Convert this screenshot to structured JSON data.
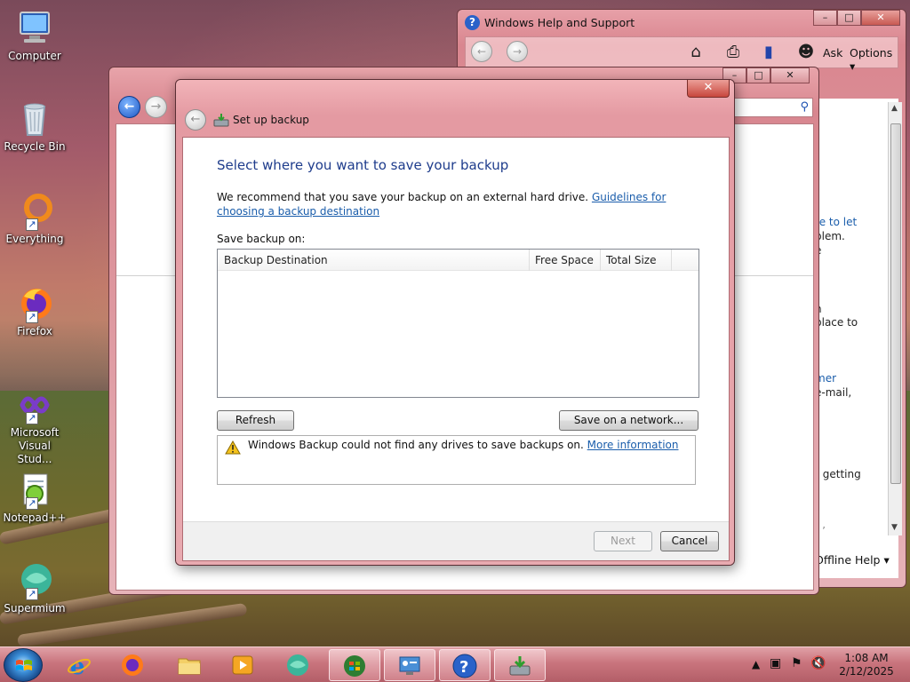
{
  "desktop": {
    "icons": [
      {
        "label": "Computer",
        "icon": "computer-icon"
      },
      {
        "label": "Recycle Bin",
        "icon": "recycle-bin-icon"
      },
      {
        "label": "Everything",
        "icon": "everything-icon"
      },
      {
        "label": "Firefox",
        "icon": "firefox-icon"
      },
      {
        "label": "Microsoft Visual Stud...",
        "icon": "visual-studio-icon"
      },
      {
        "label": "Notepad++",
        "icon": "notepadpp-icon"
      },
      {
        "label": "Supermium",
        "icon": "supermium-icon"
      }
    ]
  },
  "help_window": {
    "title": "Windows Help and Support",
    "toolbar": {
      "ask_label": "Ask",
      "options_label": "Options"
    },
    "snippets": [
      "te to let",
      "blem.",
      "e",
      "n",
      "place to",
      "mer",
      "e-mail,",
      "r getting",
      "- ’"
    ],
    "offline_label": "Offline Help"
  },
  "dialog": {
    "title": "Set up backup",
    "heading": "Select where you want to save your backup",
    "recommend_text": "We recommend that you save your backup on an external hard drive.",
    "guidelines_link": "Guidelines for choosing a backup destination",
    "save_on_label": "Save backup on:",
    "columns": [
      "Backup Destination",
      "Free Space",
      "Total Size"
    ],
    "refresh_button": "Refresh",
    "save_network_button": "Save on a network...",
    "warning_text": "Windows Backup could not find any drives to save backups on.",
    "more_info_link": "More information",
    "next_button": "Next",
    "cancel_button": "Cancel"
  },
  "taskbar": {
    "time": "1:08 AM",
    "date": "2/12/2025"
  },
  "colors": {
    "accent": "#1e3c8c",
    "link": "#1a5dab",
    "taskbar": "#c9747d"
  }
}
